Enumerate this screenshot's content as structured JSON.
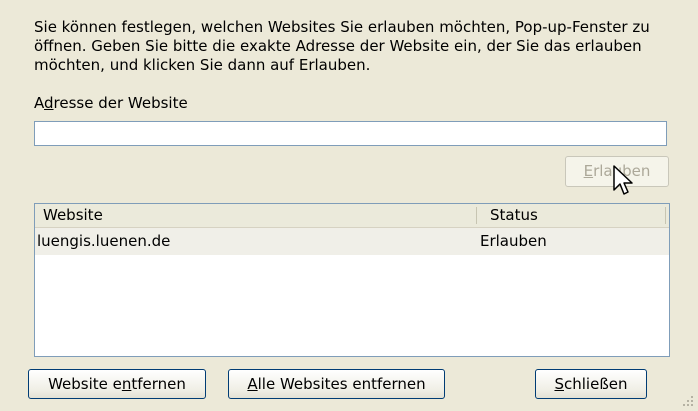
{
  "description": "Sie können festlegen, welchen Websites Sie erlauben möchten, Pop-up-Fenster zu öffnen. Geben Sie bitte die exakte Adresse der Website ein, der Sie das erlauben möchten, und klicken Sie dann auf Erlauben.",
  "address": {
    "label_pre": "A",
    "label_accel": "d",
    "label_post": "resse der Website",
    "value": ""
  },
  "allow_button": {
    "accel": "E",
    "rest": "rlauben",
    "enabled": false
  },
  "list": {
    "columns": [
      "Website",
      "Status"
    ],
    "rows": [
      {
        "site": "luengis.luenen.de",
        "status": "Erlauben"
      }
    ]
  },
  "buttons": {
    "remove_pre": "Website e",
    "remove_accel": "n",
    "remove_post": "tfernen",
    "remove_all_accel": "A",
    "remove_all_rest": "lle Websites entfernen",
    "close_accel": "S",
    "close_rest": "chließen"
  },
  "cursor_icon": "arrow-pointer-icon"
}
